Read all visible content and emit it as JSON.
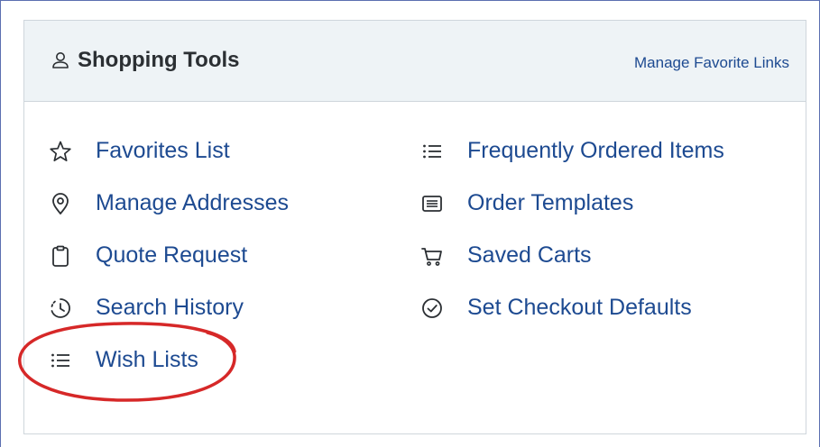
{
  "header": {
    "title": "Shopping Tools",
    "manage_link": "Manage Favorite Links"
  },
  "left_column": [
    {
      "label": "Favorites List",
      "icon": "star-icon"
    },
    {
      "label": "Manage Addresses",
      "icon": "location-pin-icon"
    },
    {
      "label": "Quote Request",
      "icon": "clipboard-icon"
    },
    {
      "label": "Search History",
      "icon": "history-clock-icon"
    },
    {
      "label": "Wish Lists",
      "icon": "list-icon"
    }
  ],
  "right_column": [
    {
      "label": "Frequently Ordered Items",
      "icon": "list-icon"
    },
    {
      "label": "Order Templates",
      "icon": "template-icon"
    },
    {
      "label": "Saved Carts",
      "icon": "cart-icon"
    },
    {
      "label": "Set Checkout Defaults",
      "icon": "check-circle-icon"
    }
  ],
  "colors": {
    "link": "#1d4a91",
    "header_bg": "#eef3f6",
    "annotation": "#d62828"
  }
}
